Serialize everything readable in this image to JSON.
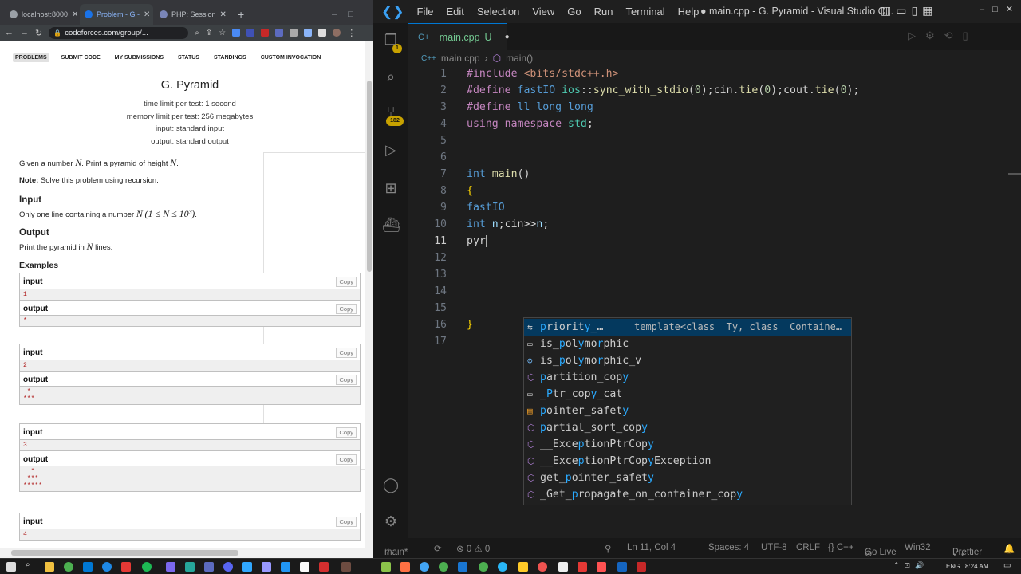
{
  "browser": {
    "tabs": [
      {
        "label": "localhost:8000",
        "color": "#9aa0a6"
      },
      {
        "label": "Problem - G - ",
        "color": "#1a73e8"
      },
      {
        "label": "PHP: Session",
        "color": "#7a86b8"
      }
    ],
    "new_tab": "+",
    "url": "codeforces.com/group/..."
  },
  "problem": {
    "menu": [
      "PROBLEMS",
      "SUBMIT CODE",
      "MY SUBMISSIONS",
      "STATUS",
      "STANDINGS",
      "CUSTOM INVOCATION"
    ],
    "title": "G. Pyramid",
    "time_limit": "time limit per test: 1 second",
    "memory_limit": "memory limit per test: 256 megabytes",
    "input": "input: standard input",
    "output": "output: standard output",
    "statement_pre": "Given a number ",
    "statement_mid": ". Print a pyramid of height ",
    "statement_end": ".",
    "var_n": "N",
    "note_label": "Note:",
    "note_text": " Solve this problem using recursion.",
    "input_title": "Input",
    "input_text": "Only one line containing a number ",
    "input_constraint": "(1 ≤ N ≤ 10³)",
    "input_end": ".",
    "output_title": "Output",
    "output_text_pre": "Print the pyramid in ",
    "output_text_post": " lines.",
    "examples_title": "Examples",
    "copy_label": "Copy",
    "input_label": "input",
    "output_label": "output",
    "examples": [
      {
        "in": "1",
        "out": "*"
      },
      {
        "in": "2",
        "out": " *\n***"
      },
      {
        "in": "3",
        "out": "  *\n ***\n*****"
      },
      {
        "in": "4"
      }
    ]
  },
  "vscode": {
    "menu": [
      "File",
      "Edit",
      "Selection",
      "View",
      "Go",
      "Run",
      "Terminal",
      "Help"
    ],
    "window_title": "● main.cpp - G. Pyramid - Visual Studio C...",
    "tab": {
      "name": "main.cpp",
      "status": "U"
    },
    "breadcrumb": [
      "main.cpp",
      "main()"
    ],
    "badges": {
      "explorer": "1",
      "scm": "182"
    },
    "lines": [
      "1",
      "2",
      "3",
      "4",
      "5",
      "6",
      "7",
      "8",
      "9",
      "10",
      "11",
      "12",
      "13",
      "14",
      "15",
      "16",
      "17"
    ],
    "code": {
      "l1_a": "#include ",
      "l1_b": "<bits/stdc++.h>",
      "l2_a": "#define ",
      "l2_b": "fastIO",
      "l2_c": " ios",
      "l2_d": "::",
      "l2_e": "sync_with_stdio",
      "l2_f": "(",
      "l2_g": "0",
      "l2_h": ");cin.",
      "l2_i": "tie",
      "l2_j": "(",
      "l2_k": "0",
      "l2_l": ");cout.",
      "l2_m": "tie",
      "l2_n": "(",
      "l2_o": "0",
      "l2_p": ");",
      "l3_a": "#define ",
      "l3_b": "ll",
      "l3_c": " long long",
      "l4_a": "using namespace ",
      "l4_b": "std",
      "l4_c": ";",
      "l7_a": "int ",
      "l7_b": "main",
      "l7_c": "()",
      "l8": "{",
      "l9": "fastIO",
      "l10_a": "int ",
      "l10_b": "n",
      "l10_c": ";cin>>",
      "l10_d": "n",
      "l10_e": ";",
      "l11": "pyr",
      "l16": "}"
    },
    "suggestions": [
      {
        "icon": "⇆",
        "text": "priority_…",
        "detail": "template<class _Ty, class _Containe…"
      },
      {
        "icon": "▭",
        "text": "is_polymorphic"
      },
      {
        "icon": "⊙",
        "text": "is_polymorphic_v"
      },
      {
        "icon": "⬡",
        "text": "partition_copy"
      },
      {
        "icon": "▭",
        "text": "_Ptr_copy_cat"
      },
      {
        "icon": "▤",
        "text": "pointer_safety"
      },
      {
        "icon": "⬡",
        "text": "partial_sort_copy"
      },
      {
        "icon": "⬡",
        "text": "__ExceptionPtrCopy"
      },
      {
        "icon": "⬡",
        "text": "__ExceptionPtrCopyException"
      },
      {
        "icon": "⬡",
        "text": "get_pointer_safety"
      },
      {
        "icon": "⬡",
        "text": "_Get_propagate_on_container_copy"
      }
    ],
    "status": {
      "branch": "main*",
      "problems": "⊗ 0 ⚠ 0",
      "position": "Ln 11, Col 4",
      "spaces": "Spaces: 4",
      "encoding": "UTF-8",
      "eol": "CRLF",
      "language": "{} C++",
      "golive": "Go Live",
      "platform": "Win32",
      "prettier": "Prettier"
    }
  },
  "taskbar": {
    "lang": "ENG",
    "time": "8:24 AM"
  }
}
